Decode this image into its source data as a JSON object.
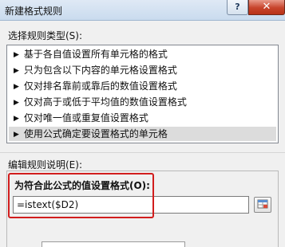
{
  "window": {
    "title": "新建格式规则",
    "help_label": "?",
    "close_label": "✕"
  },
  "rule_type": {
    "label": "选择规则类型(S):",
    "items": [
      {
        "label": "基于各自值设置所有单元格的格式"
      },
      {
        "label": "只为包含以下内容的单元格设置格式"
      },
      {
        "label": "仅对排名靠前或靠后的数值设置格式"
      },
      {
        "label": "仅对高于或低于平均值的数值设置格式"
      },
      {
        "label": "仅对唯一值或重复值设置格式"
      },
      {
        "label": "使用公式确定要设置格式的单元格"
      }
    ],
    "selected_index": 5,
    "arrow": "▶"
  },
  "description": {
    "label": "编辑规则说明(E):",
    "formula_label": "为符合此公式的值设置格式(O):",
    "formula_value": "=istext($D2)"
  },
  "colors": {
    "highlight": "#d11d1d",
    "selected_row": "#dcdcdc"
  },
  "icons": {
    "collapse": "range-select-icon",
    "item_marker": "triangle-right-icon"
  }
}
